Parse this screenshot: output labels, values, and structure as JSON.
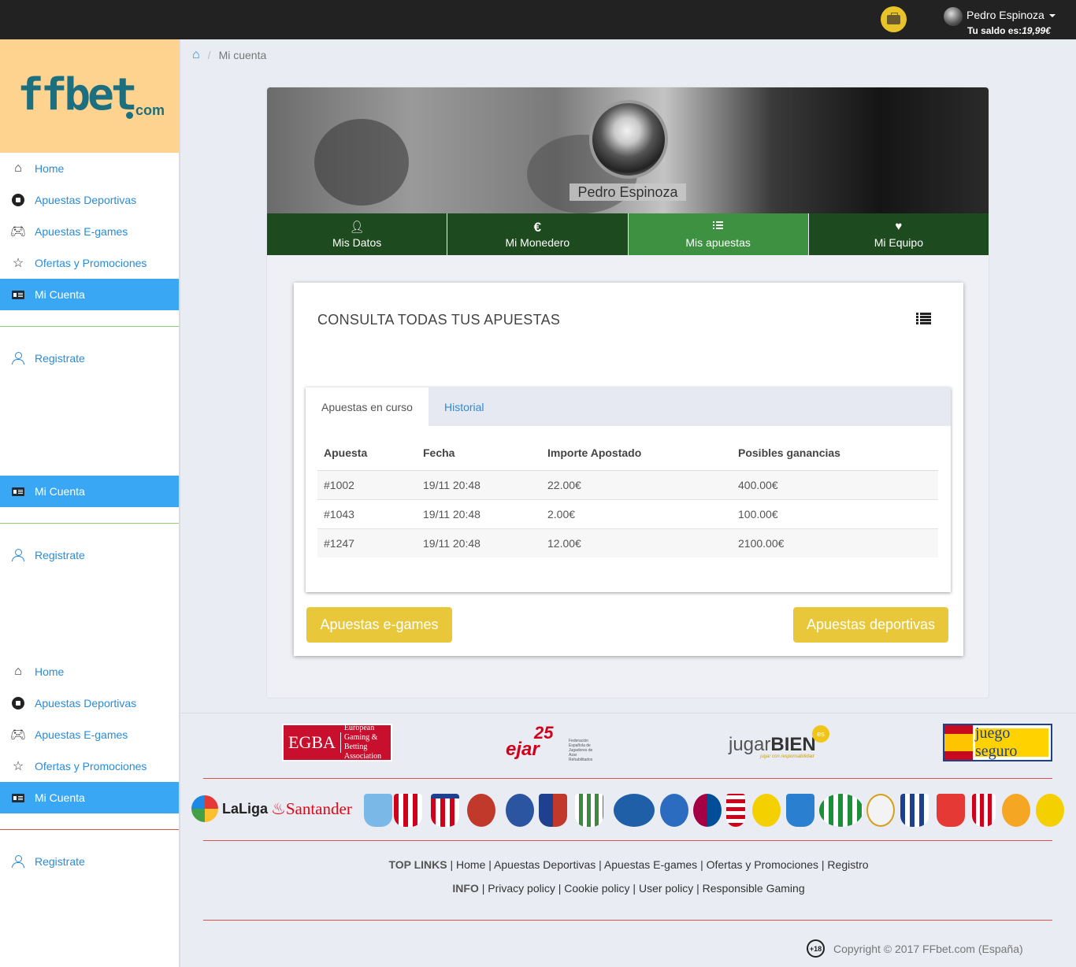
{
  "topbar": {
    "user_name": "Pedro Espinoza",
    "balance_label": "Tu saldo es:",
    "balance_value": "19,99€"
  },
  "sidebar": {
    "logo": "ffbet.com",
    "logo_main": "ffbet",
    "logo_suffix": "com",
    "menus": [
      {
        "items": [
          {
            "label": "Home",
            "icon": "house-icon"
          },
          {
            "label": "Apuestas Deportivas",
            "icon": "soccer-ball-icon"
          },
          {
            "label": "Apuestas E-games",
            "icon": "gamepad-icon"
          },
          {
            "label": "Ofertas y Promociones",
            "icon": "star-icon"
          },
          {
            "label": "Mi Cuenta",
            "icon": "id-card-icon",
            "active": true
          }
        ],
        "register": "Registrate"
      },
      {
        "items": [
          {
            "label": "Mi Cuenta",
            "icon": "id-card-icon",
            "active": true
          }
        ],
        "register": "Registrate"
      },
      {
        "items": [
          {
            "label": "Home",
            "icon": "house-icon"
          },
          {
            "label": "Apuestas Deportivas",
            "icon": "soccer-ball-icon"
          },
          {
            "label": "Apuestas E-games",
            "icon": "gamepad-icon"
          },
          {
            "label": "Ofertas y Promociones",
            "icon": "star-icon"
          },
          {
            "label": "Mi Cuenta",
            "icon": "id-card-icon",
            "active": true
          }
        ],
        "register": "Registrate"
      }
    ]
  },
  "breadcrumb": {
    "current": "Mi cuenta"
  },
  "profile": {
    "name": "Pedro Espinoza",
    "tabs": [
      {
        "label": "Mis Datos",
        "icon": "user-icon"
      },
      {
        "label": "Mi Monedero",
        "icon": "euro-icon"
      },
      {
        "label": "Mis apuestas",
        "icon": "list-icon",
        "active": true
      },
      {
        "label": "Mi Equipo",
        "icon": "heart-icon"
      }
    ]
  },
  "bets": {
    "title": "CONSULTA TODAS TUS APUESTAS",
    "tabs": [
      "Apuestas en curso",
      "Historial"
    ],
    "columns": [
      "Apuesta",
      "Fecha",
      "Importe Apostado",
      "Posibles ganancias"
    ],
    "rows": [
      [
        "#1002",
        "19/11 20:48",
        "22.00€",
        "400.00€"
      ],
      [
        "#1043",
        "19/11 20:48",
        "2.00€",
        "100.00€"
      ],
      [
        "#1247",
        "19/11 20:48",
        "12.00€",
        "2100.00€"
      ]
    ],
    "btn_egames": "Apuestas e-games",
    "btn_sports": "Apuestas deportivas"
  },
  "footer": {
    "egba_big": "EGBA",
    "egba_small": "European Gaming & Betting Association",
    "jugar": "jugar",
    "bien": "BIEN",
    "es": "es",
    "jugar_sub": "jugar con responsabilidad",
    "juego_seguro": "juego seguro",
    "laliga": "LaLiga",
    "santander": "Santander",
    "top_links_label": "TOP LINKS",
    "top_links": [
      "Home",
      "Apuestas Deportivas",
      "Apuestas E-games",
      "Ofertas y Promociones",
      "Registro"
    ],
    "info_label": "INFO",
    "info_links": [
      "Privacy policy",
      "Cookie policy",
      "User policy",
      "Responsible Gaming"
    ],
    "age": "+18",
    "copyright": "Copyright © 2017 FFbet.com (España)"
  },
  "colors": {
    "tab_green": "#1e4a1f",
    "tab_active": "#3d9140",
    "accent_blue": "#3aa7f5",
    "button_yellow": "#e8c83a"
  }
}
